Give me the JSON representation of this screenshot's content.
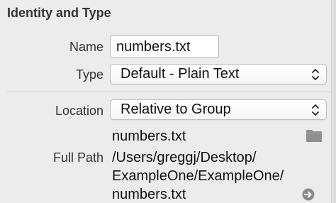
{
  "inspector": {
    "section_title": "Identity and Type",
    "name": {
      "label": "Name",
      "value": "numbers.txt"
    },
    "type": {
      "label": "Type",
      "selected": "Default - Plain Text"
    },
    "location": {
      "label": "Location",
      "selected": "Relative to Group",
      "file_name": "numbers.txt"
    },
    "full_path": {
      "label": "Full Path",
      "lines": [
        "/Users/greggj/Desktop/",
        "ExampleOne/ExampleOne/",
        "numbers.txt"
      ]
    }
  },
  "icons": {
    "popup_arrows": "up-down-chevrons-icon",
    "folder": "folder-icon",
    "reveal": "arrow-circle-right-icon"
  },
  "colors": {
    "panel_background": "#ececec",
    "field_border": "#b9b9b9",
    "icon_gray": "#8a8a8a"
  }
}
